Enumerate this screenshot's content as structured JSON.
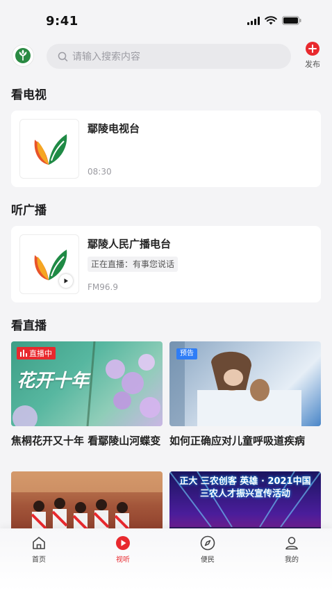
{
  "status_bar": {
    "time": "9:41"
  },
  "header": {
    "search_placeholder": "请输入搜索内容",
    "publish_label": "发布"
  },
  "tv_section": {
    "title": "看电视",
    "card": {
      "name": "鄢陵电视台",
      "time": "08:30"
    }
  },
  "radio_section": {
    "title": "听广播",
    "card": {
      "name": "鄢陵人民广播电台",
      "now_playing": "正在直播：有事您说话",
      "frequency": "FM96.9"
    }
  },
  "live_section": {
    "title": "看直播",
    "items": [
      {
        "badge": "直播中",
        "title": "焦桐花开又十年 看鄢陵山河蝶变",
        "image_text": "花开十年"
      },
      {
        "badge": "预告",
        "title": "如何正确应对儿童呼吸道疾病"
      },
      {
        "image_text": ""
      },
      {
        "image_text": "正大 三农创客 英雄 · 2021中国三农人才振兴宣传活动"
      }
    ]
  },
  "tabbar": {
    "items": [
      {
        "label": "首页",
        "icon": "home-icon"
      },
      {
        "label": "视听",
        "icon": "play-icon",
        "active": true
      },
      {
        "label": "便民",
        "icon": "compass-icon"
      },
      {
        "label": "我的",
        "icon": "user-icon"
      }
    ]
  },
  "colors": {
    "accent": "#e8292e",
    "preview": "#2f7df6"
  }
}
